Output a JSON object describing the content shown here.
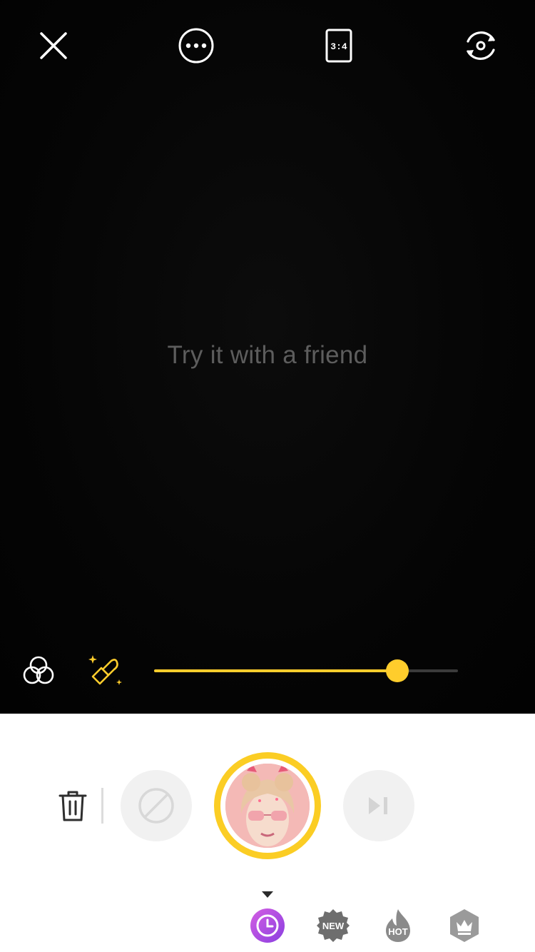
{
  "top_bar": {
    "close_icon": "close-icon",
    "more_icon": "more-icon",
    "ratio_label": "3:4",
    "flip_icon": "flip-camera-icon"
  },
  "viewfinder": {
    "hint": "Try it with a friend"
  },
  "tools": {
    "filter_icon": "filter-icon",
    "beauty_icon": "beauty-wand-icon",
    "intensity_fraction": 0.8,
    "accent_color": "#FFCD2C"
  },
  "tray": {
    "delete_icon": "trash-icon",
    "none_icon": "no-effect-icon",
    "skip_icon": "skip-icon",
    "shutter_ring_color": "#FBCD24"
  },
  "categories": [
    {
      "key": "recent",
      "icon": "clock-icon",
      "label": ""
    },
    {
      "key": "new",
      "icon": "new-badge-icon",
      "label": "NEW"
    },
    {
      "key": "hot",
      "icon": "flame-icon",
      "label": "HOT"
    },
    {
      "key": "premium",
      "icon": "crown-icon",
      "label": ""
    }
  ]
}
